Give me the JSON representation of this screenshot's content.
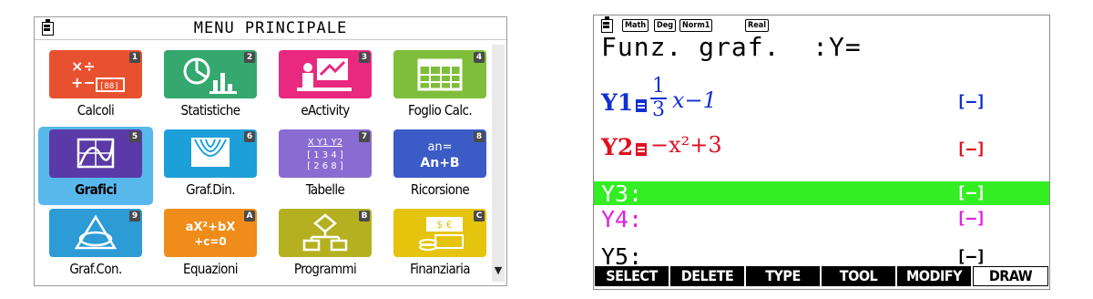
{
  "menu": {
    "title": "MENU PRINCIPALE",
    "tiles": [
      {
        "label": "Calcoli",
        "num": "1",
        "color": "#e8512f"
      },
      {
        "label": "Statistiche",
        "num": "2",
        "color": "#34a86e"
      },
      {
        "label": "eActivity",
        "num": "3",
        "color": "#e8297f"
      },
      {
        "label": "Foglio Calc.",
        "num": "4",
        "color": "#7fbe3a"
      },
      {
        "label": "Grafici",
        "num": "5",
        "color": "#5a3aa6"
      },
      {
        "label": "Graf.Din.",
        "num": "6",
        "color": "#1d9fd9"
      },
      {
        "label": "Tabelle",
        "num": "7",
        "color": "#8a6bd1"
      },
      {
        "label": "Ricorsione",
        "num": "8",
        "color": "#3b5bc7"
      },
      {
        "label": "Graf.Con.",
        "num": "9",
        "color": "#2c9bd6"
      },
      {
        "label": "Equazioni",
        "num": "A",
        "color": "#f08c1a"
      },
      {
        "label": "Programmi",
        "num": "B",
        "color": "#b5b020"
      },
      {
        "label": "Finanziaria",
        "num": "C",
        "color": "#e5c40e"
      }
    ],
    "icon_text": {
      "calc": "×÷\n+−",
      "ricorsione": "an=\nAn+B",
      "equazioni": "aX²+bX\n+c=0",
      "tabelle": "X Y1Y2\n[1 3 4]\n[2 6 8]"
    },
    "scroll_arrow": "▼",
    "selected_index": 4
  },
  "graph": {
    "status": {
      "math": "Math",
      "deg": "Deg",
      "norm": "Norm1",
      "real": "Real"
    },
    "title": "Funz. graf.  :Y=",
    "rows": [
      {
        "name": "Y1",
        "color": "#1030d0",
        "expr_prefix": "",
        "num": "1",
        "den": "3",
        "expr_suffix": "x−1",
        "style": "[—]"
      },
      {
        "name": "Y2",
        "color": "#e01020",
        "expr": "−x²+3",
        "style": "[—]"
      },
      {
        "name": "Y3:",
        "color": "#ffffff",
        "expr": "",
        "style": "[—]"
      },
      {
        "name": "Y4:",
        "color": "#e020e0",
        "expr": "",
        "style": "[—]"
      },
      {
        "name": "Y5:",
        "color": "#000000",
        "expr": "",
        "style": "[—]"
      }
    ],
    "fkeys": [
      "SELECT",
      "DELETE",
      "TYPE",
      "TOOL",
      "MODIFY",
      "DRAW"
    ]
  }
}
